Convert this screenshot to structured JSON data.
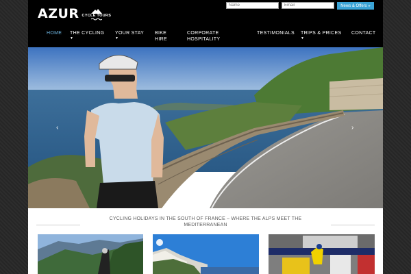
{
  "brand": {
    "name": "AZUR",
    "subtitle": "CYCLE TOURS"
  },
  "signup": {
    "name_placeholder": "Name",
    "email_placeholder": "Email",
    "button_label": "News & Offers »"
  },
  "nav": {
    "items": [
      {
        "label": "HOME",
        "active": true,
        "has_submenu": false
      },
      {
        "label": "THE CYCLING",
        "active": false,
        "has_submenu": true
      },
      {
        "label": "YOUR STAY",
        "active": false,
        "has_submenu": true
      },
      {
        "label": "BIKE HIRE",
        "active": false,
        "has_submenu": false
      },
      {
        "label": "CORPORATE HOSPITALITY",
        "active": false,
        "has_submenu": false
      },
      {
        "label": "TESTIMONIALS",
        "active": false,
        "has_submenu": false
      },
      {
        "label": "TRIPS & PRICES",
        "active": false,
        "has_submenu": true
      },
      {
        "label": "CONTACT",
        "active": false,
        "has_submenu": false
      }
    ]
  },
  "hero": {
    "prev_label": "‹",
    "next_label": "›"
  },
  "tagline": "CYCLING HOLIDAYS IN THE SOUTH OF FRANCE – WHERE THE ALPS MEET THE MEDITERRANEAN",
  "colors": {
    "header_bg": "#000000",
    "accent": "#3aa3d6",
    "active_nav": "#6fb6e1"
  }
}
